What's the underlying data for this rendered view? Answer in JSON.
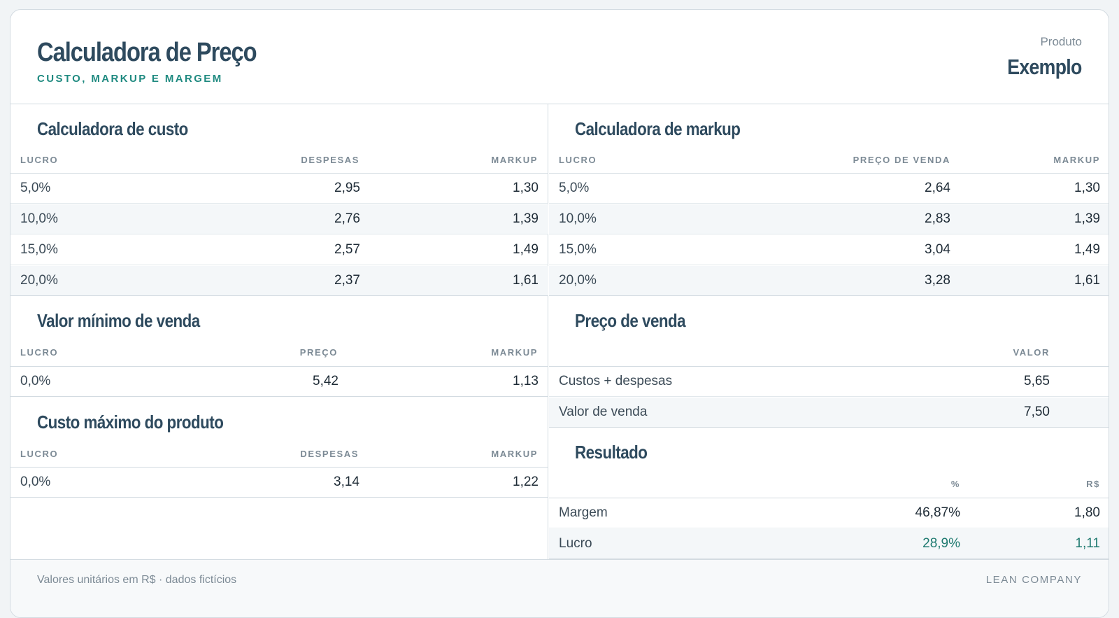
{
  "header": {
    "title": "Calculadora de Preço",
    "subtitle": "CUSTO, MARKUP E MARGEM",
    "product_label": "Produto",
    "product_name": "Exemplo"
  },
  "cost_calc": {
    "title": "Calculadora de custo",
    "headers": [
      "LUCRO",
      "DESPESAS",
      "MARKUP"
    ],
    "rows": [
      [
        "5,0%",
        "2,95",
        "1,30"
      ],
      [
        "10,0%",
        "2,76",
        "1,39"
      ],
      [
        "15,0%",
        "2,57",
        "1,49"
      ],
      [
        "20,0%",
        "2,37",
        "1,61"
      ]
    ]
  },
  "markup_calc": {
    "title": "Calculadora de markup",
    "headers": [
      "LUCRO",
      "PREÇO DE VENDA",
      "MARKUP"
    ],
    "rows": [
      [
        "5,0%",
        "2,64",
        "1,30"
      ],
      [
        "10,0%",
        "2,83",
        "1,39"
      ],
      [
        "15,0%",
        "3,04",
        "1,49"
      ],
      [
        "20,0%",
        "3,28",
        "1,61"
      ]
    ]
  },
  "min_sale": {
    "title": "Valor mínimo de venda",
    "headers": [
      "LUCRO",
      "PREÇO",
      "MARKUP"
    ],
    "rows": [
      [
        "0,0%",
        "5,42",
        "1,13"
      ]
    ]
  },
  "max_cost": {
    "title": "Custo máximo do produto",
    "headers": [
      "LUCRO",
      "DESPESAS",
      "MARKUP"
    ],
    "rows": [
      [
        "0,0%",
        "3,14",
        "1,22"
      ]
    ]
  },
  "sale_price": {
    "title": "Preço de venda",
    "headers": [
      "VALOR"
    ],
    "rows": [
      [
        "Custos + despesas",
        "5,65"
      ],
      [
        "Valor de venda",
        "7,50"
      ]
    ]
  },
  "result": {
    "title": "Resultado",
    "headers": [
      "%",
      "R$"
    ],
    "rows": [
      [
        "Margem",
        "46,87%",
        "1,80"
      ],
      [
        "Lucro",
        "28,9%",
        "1,11"
      ]
    ]
  },
  "footer": {
    "note": "Valores unitários em R$ · dados fictícios",
    "brand": "LEAN COMPANY"
  },
  "colors": {
    "title": "#2e4a5e",
    "accent": "#1f8a80",
    "positive": "#1f7a70",
    "muted": "#7c8a95"
  }
}
